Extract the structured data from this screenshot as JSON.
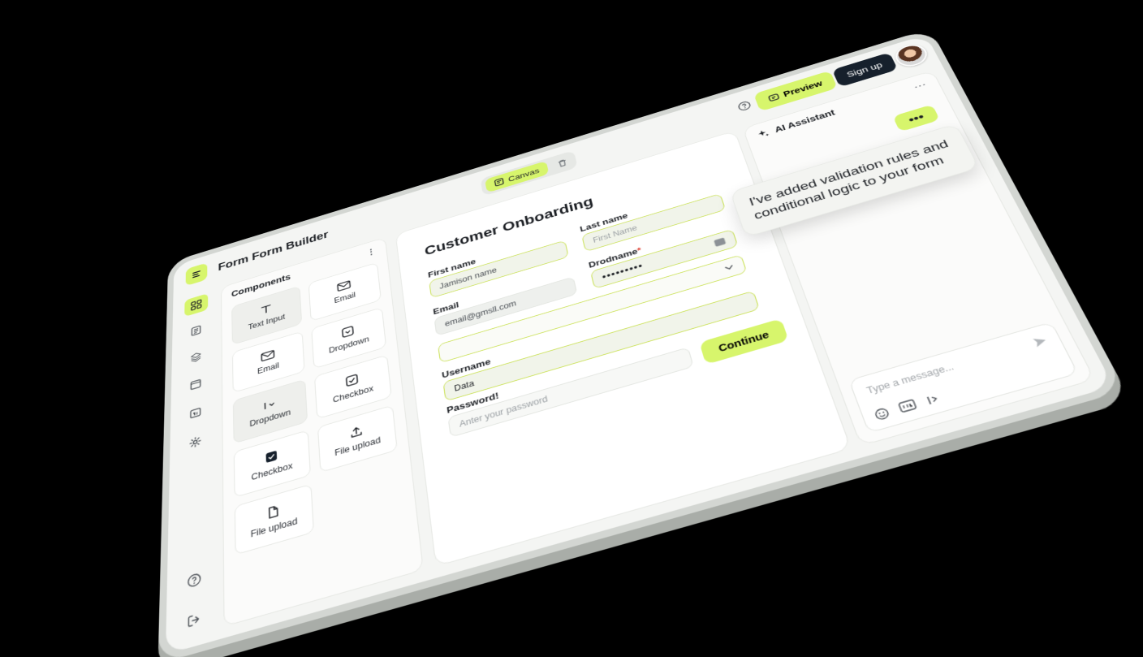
{
  "app": {
    "title": "Form Form Builder"
  },
  "toolbar": {
    "canvas_label": "Canvas",
    "preview_label": "Preview",
    "signup_label": "Sign up"
  },
  "components": {
    "title": "Components",
    "items": [
      "Text Input",
      "Email",
      "Email",
      "Dropdown",
      "Dropdown",
      "Checkbox",
      "Checkbox",
      "File upload",
      "File upload"
    ]
  },
  "form": {
    "title": "Customer Onboarding",
    "first_name": {
      "label": "First name",
      "value": "Jamison name"
    },
    "last_name": {
      "label": "Last name",
      "placeholder": "First Name"
    },
    "email": {
      "label": "Email",
      "value": "email@gmsll.com"
    },
    "dropdown": {
      "label": "Drodname",
      "value": "•••••••••"
    },
    "username": {
      "label": "Username",
      "value": "Data"
    },
    "password": {
      "label": "Password!",
      "placeholder": "Anter your password"
    },
    "continue_label": "Continue"
  },
  "ai": {
    "title": "AI Assistant",
    "typing": "•••",
    "message": "I've added validation rules and conditional logic to your form",
    "input_placeholder": "Type a message..."
  },
  "colors": {
    "accent": "#d7f56c",
    "dark": "#16202c",
    "required": "#e0463a"
  }
}
